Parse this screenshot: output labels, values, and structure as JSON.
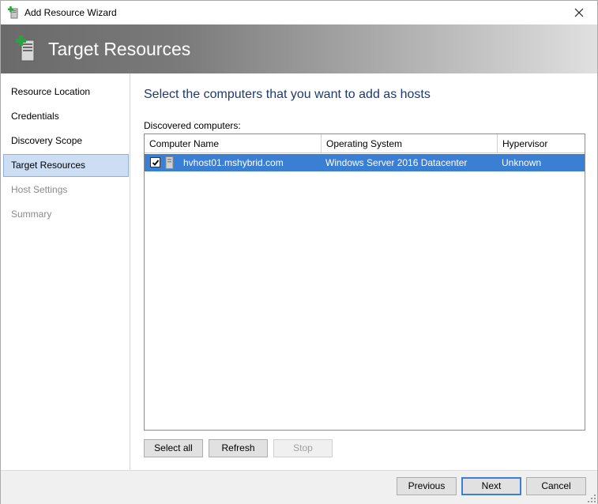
{
  "window": {
    "title": "Add Resource Wizard",
    "close_icon": "close-icon",
    "app_icon": "add-resource-icon"
  },
  "banner": {
    "title": "Target Resources",
    "icon": "server-add-icon"
  },
  "sidebar": {
    "items": [
      {
        "label": "Resource Location",
        "state": "normal"
      },
      {
        "label": "Credentials",
        "state": "normal"
      },
      {
        "label": "Discovery Scope",
        "state": "normal"
      },
      {
        "label": "Target Resources",
        "state": "active"
      },
      {
        "label": "Host Settings",
        "state": "disabled"
      },
      {
        "label": "Summary",
        "state": "disabled"
      }
    ]
  },
  "main": {
    "heading": "Select the computers that you want to add as hosts",
    "list_label": "Discovered computers:",
    "columns": [
      "Computer Name",
      "Operating System",
      "Hypervisor"
    ],
    "rows": [
      {
        "checked": true,
        "computer_name": "hvhost01.mshybrid.com",
        "operating_system": "Windows Server 2016 Datacenter",
        "hypervisor": "Unknown",
        "selected": true
      }
    ],
    "buttons": {
      "select_all": "Select all",
      "refresh": "Refresh",
      "stop": "Stop"
    }
  },
  "footer": {
    "previous": "Previous",
    "next": "Next",
    "cancel": "Cancel"
  },
  "colors": {
    "selection": "#3a7fd4",
    "heading": "#1e3a6e",
    "active_nav": "#ccdef4"
  }
}
